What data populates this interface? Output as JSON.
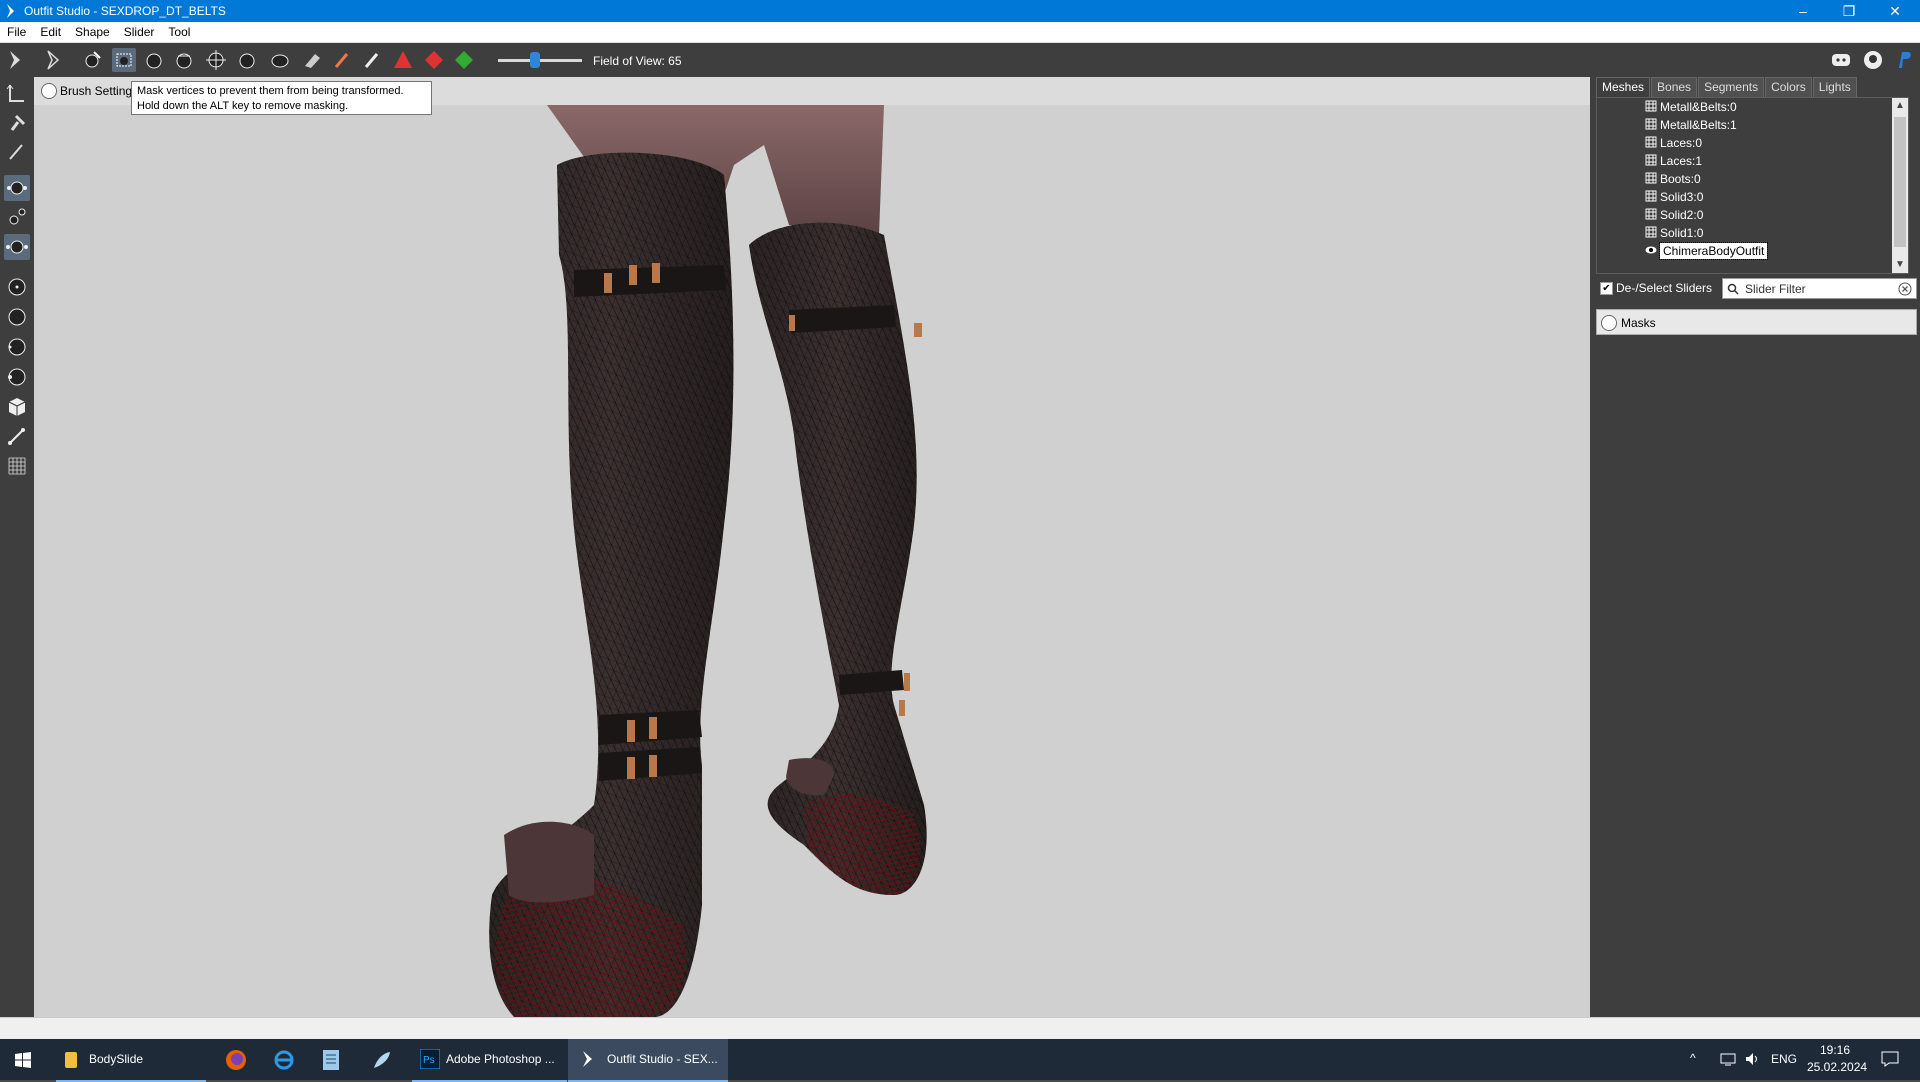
{
  "window": {
    "title": "Outfit Studio - SEXDROP_DT_BELTS",
    "minimize": "–",
    "restore": "❐",
    "close": "✕"
  },
  "menu": [
    "File",
    "Edit",
    "Shape",
    "Slider",
    "Tool"
  ],
  "toolbar": {
    "tools": [
      "select-tool-icon",
      "transform-tool-icon",
      "mask-brush-icon",
      "inflate-brush-icon",
      "deflate-brush-icon",
      "move-brush-icon",
      "smooth-brush-icon",
      "undiff-brush-icon",
      "erase-brush-icon",
      "weight-brush-icon",
      "color-brush-icon",
      "alpha-brush-icon",
      "collapse-vertex-icon",
      "flip-edge-icon",
      "split-edge-icon"
    ],
    "fov_label": "Field of View: 65",
    "fov_value": 65,
    "right_icons": [
      "discord-icon",
      "github-icon",
      "paypal-icon"
    ]
  },
  "leftbar": {
    "tools": [
      "select-mode-icon",
      "pin-icon",
      "brush-icon",
      "vertex-view-icon",
      "edge-view-icon",
      "face-view-icon",
      "point-light-icon",
      "shaded-icon",
      "smooth-shade-icon",
      "texture-icon",
      "cube-icon",
      "bone-icon",
      "grid-icon"
    ]
  },
  "viewport": {
    "brush_settings_label": "Brush Setting",
    "tooltip_line1": "Mask vertices to prevent them from being transformed.",
    "tooltip_line2": "Hold down the ALT key to remove masking."
  },
  "panel": {
    "tabs": [
      "Meshes",
      "Bones",
      "Segments",
      "Colors",
      "Lights"
    ],
    "active_tab": "Meshes",
    "meshes": [
      "Metall&Belts:0",
      "Metall&Belts:1",
      "Laces:0",
      "Laces:1",
      "Boots:0",
      "Solid3:0",
      "Solid2:0",
      "Solid1:0",
      "ChimeraBodyOutfit"
    ],
    "selected_mesh": "ChimeraBodyOutfit",
    "deselect_label": "De-/Select Sliders",
    "deselect_checked": true,
    "filter_placeholder": "Slider Filter",
    "masks_label": "Masks"
  },
  "taskbar": {
    "items": [
      {
        "label": "BodySlide",
        "icon": "bodyslide-icon"
      },
      {
        "label": "",
        "icon": "firefox-icon"
      },
      {
        "label": "",
        "icon": "internet-explorer-icon"
      },
      {
        "label": "",
        "icon": "notepad-icon"
      },
      {
        "label": "",
        "icon": "feather-icon"
      },
      {
        "label": "Adobe Photoshop ...",
        "icon": "photoshop-icon"
      },
      {
        "label": "Outfit Studio - SEX...",
        "icon": "outfit-studio-icon"
      }
    ],
    "lang": "ENG",
    "time": "19:16",
    "date": "25.02.2024"
  },
  "colors": {
    "accent": "#0078d7",
    "toolbar": "#3e3e3e",
    "viewport": "#d0d0d0",
    "taskbar": "#1f2a38"
  }
}
